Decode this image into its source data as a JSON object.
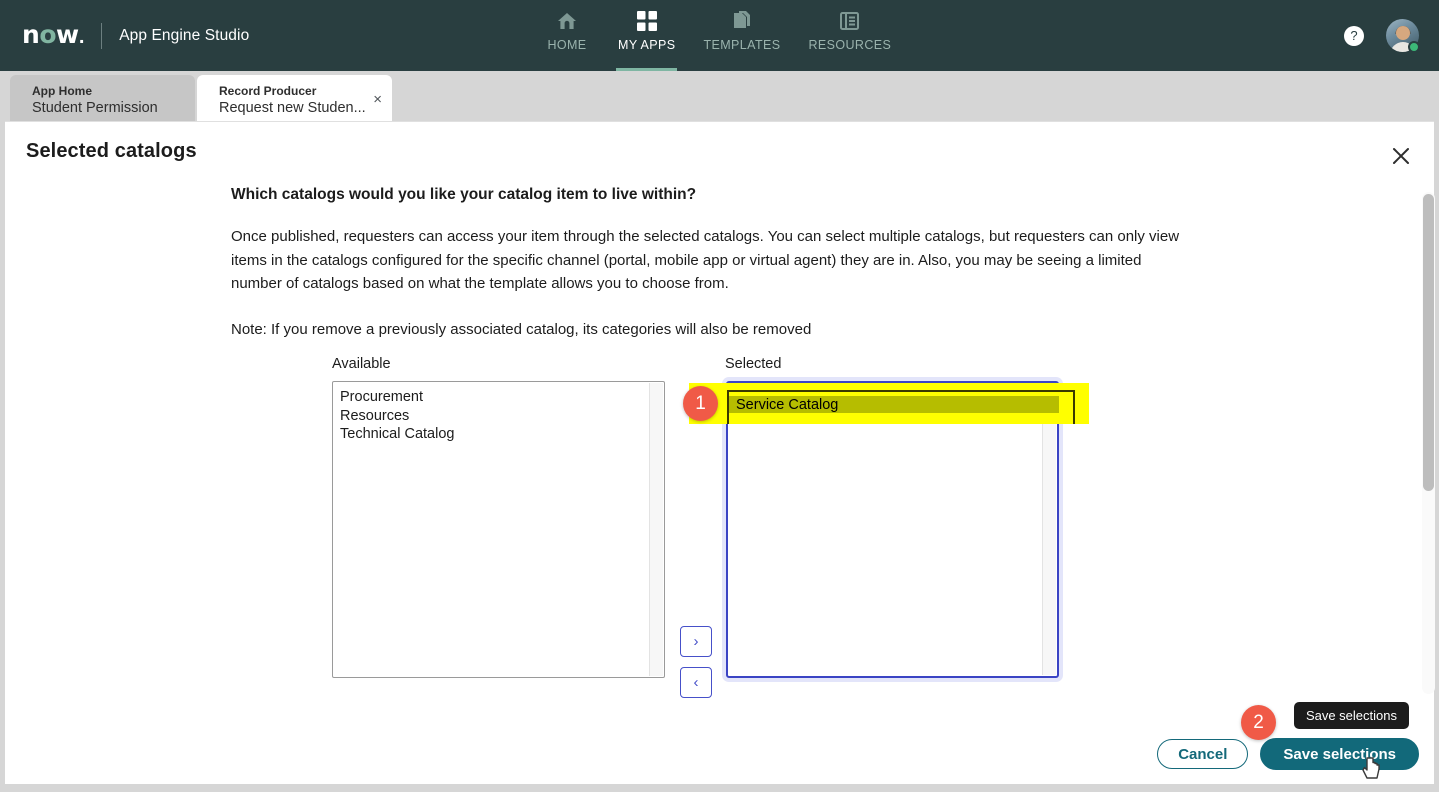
{
  "header": {
    "logo_text": "now",
    "app_title": "App Engine Studio",
    "nav": [
      {
        "label": "HOME",
        "icon": "home-icon",
        "active": false
      },
      {
        "label": "MY APPS",
        "icon": "grid-icon",
        "active": true
      },
      {
        "label": "TEMPLATES",
        "icon": "templates-icon",
        "active": false
      },
      {
        "label": "RESOURCES",
        "icon": "resources-icon",
        "active": false
      }
    ],
    "help_glyph": "?",
    "avatar_status": "online"
  },
  "tabs": [
    {
      "sub": "App Home",
      "main": "Student Permission",
      "active": false,
      "closable": false
    },
    {
      "sub": "Record Producer",
      "main": "Request new Studen...",
      "active": true,
      "closable": true,
      "close_glyph": "×"
    }
  ],
  "tabstrip_actions": {
    "collapse_glyph": "chevron-down",
    "expand_glyph": "expand-arrows"
  },
  "modal": {
    "title": "Selected catalogs",
    "close_glyph": "×",
    "question": "Which catalogs would you like your catalog item to live within?",
    "body": "Once published, requesters can access your item through the selected catalogs. You can select multiple catalogs, but requesters can only view items in the catalogs configured for the specific channel (portal, mobile app or virtual agent) they are in. Also, you may be seeing a limited number of catalogs based on what the template allows you to choose from.",
    "note": "Note: If you remove a previously associated catalog, its categories will also be removed"
  },
  "dual_list": {
    "available_label": "Available",
    "selected_label": "Selected",
    "available_items": [
      "Procurement",
      "Resources",
      "Technical Catalog"
    ],
    "selected_items": [
      "Service Catalog"
    ],
    "highlighted_selected_item": "Service Catalog",
    "move_right_glyph": "›",
    "move_left_glyph": "‹"
  },
  "annotations": {
    "badge_one": "1",
    "badge_two": "2",
    "highlight_color": "#ffff00",
    "badge_color": "#f05a47"
  },
  "footer": {
    "cancel_label": "Cancel",
    "save_label": "Save selections",
    "tooltip_text": "Save selections"
  },
  "colors": {
    "nav_background": "#293e40",
    "brand_accent": "#81b5a1",
    "primary_button": "#12697a",
    "focus_border": "#3b44c4",
    "selection_background": "#b6bd00"
  }
}
